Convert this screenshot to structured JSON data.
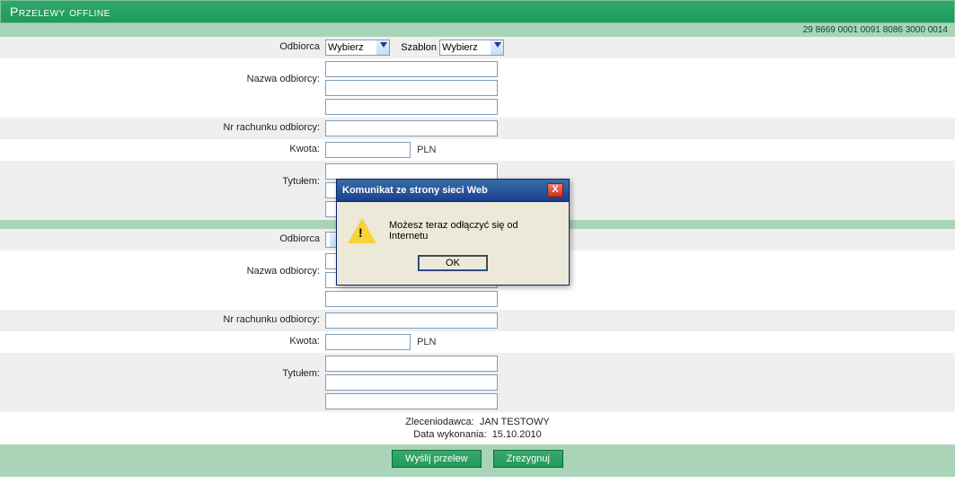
{
  "header": {
    "title": "Przelewy offline"
  },
  "account_number": "29 8669 0001 0091 8086 3000 0014",
  "labels": {
    "odbiorca": "Odbiorca",
    "szablon": "Szablon",
    "nazwa_odbiorcy": "Nazwa odbiorcy:",
    "nr_rachunku": "Nr rachunku odbiorcy:",
    "kwota": "Kwota:",
    "tytulem": "Tytułem:",
    "zleceniodawca": "Zleceniodawca:",
    "data_wykonania": "Data wykonania:"
  },
  "selects": {
    "odbiorca_option": "Wybierz",
    "szablon_option": "Wybierz"
  },
  "currency": "PLN",
  "footer": {
    "zleceniodawca_value": "JAN TESTOWY",
    "data_value": "15.10.2010"
  },
  "buttons": {
    "send": "Wyślij przelew",
    "cancel": "Zrezygnuj"
  },
  "dialog": {
    "title": "Komunikat ze strony sieci Web",
    "message": "Możesz teraz odłączyć się od Internetu",
    "ok": "OK",
    "close": "X"
  }
}
